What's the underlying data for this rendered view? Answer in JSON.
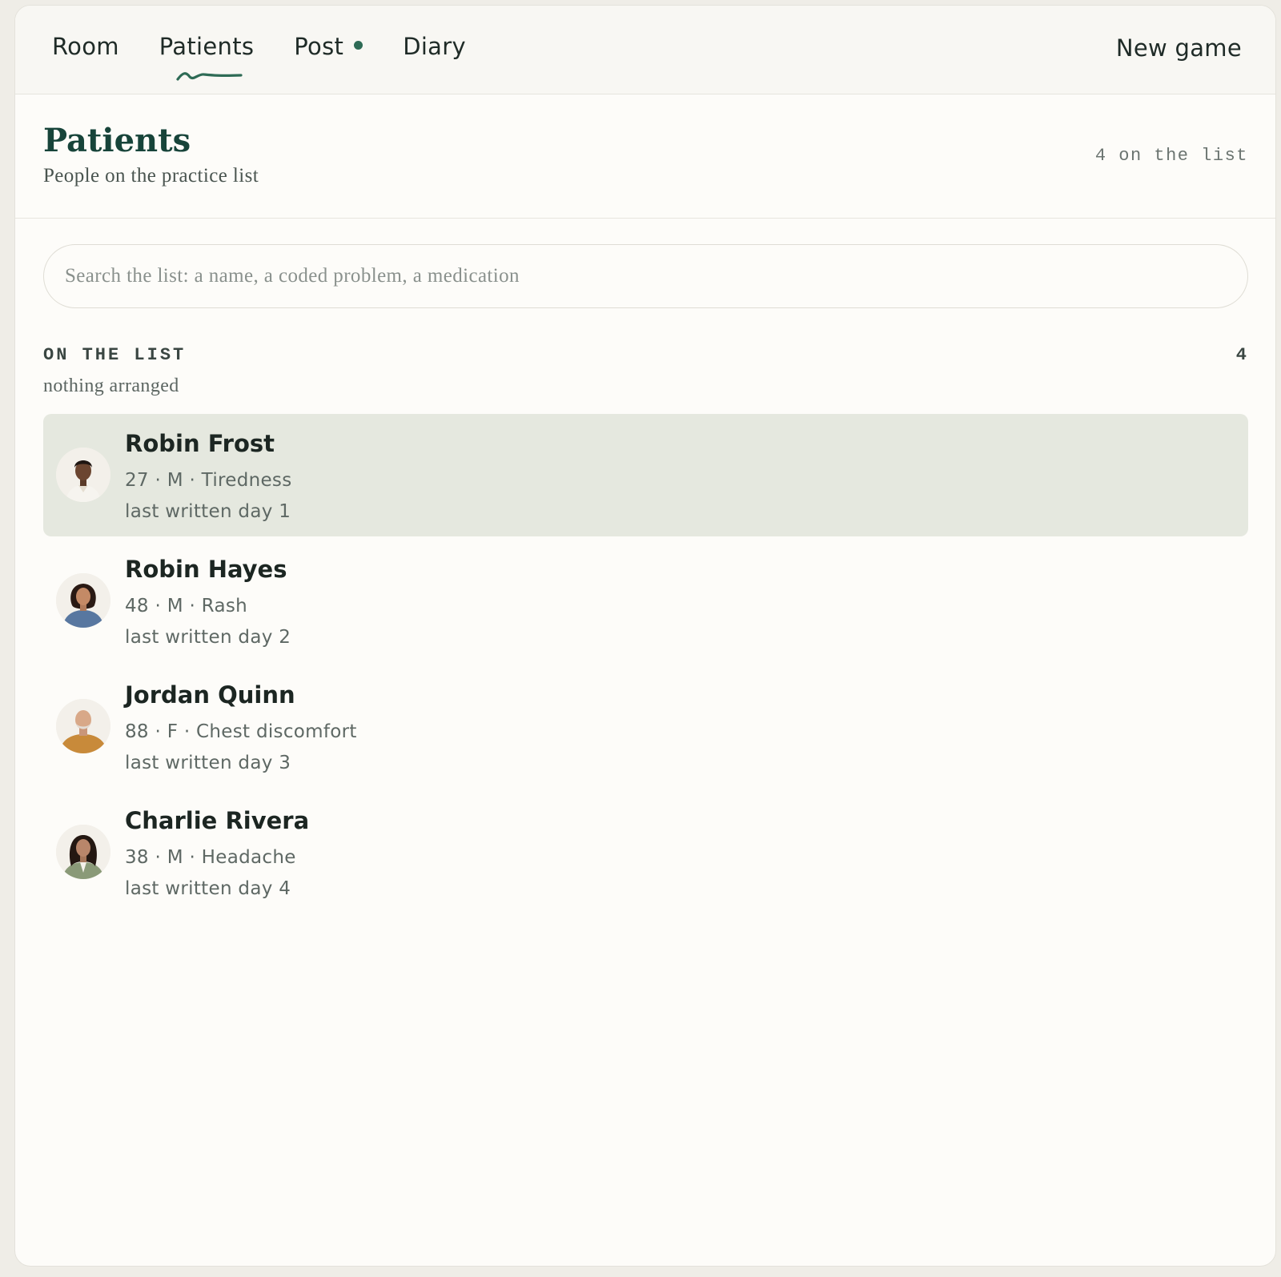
{
  "nav": {
    "tabs": [
      {
        "label": "Room"
      },
      {
        "label": "Patients"
      },
      {
        "label": "Post"
      },
      {
        "label": "Diary"
      }
    ],
    "active_tab": "Patients",
    "new_game_label": "New game",
    "accent_color": "#2e6b55"
  },
  "header": {
    "title": "Patients",
    "subtitle": "People on the practice list",
    "count_label": "4 on the list"
  },
  "search": {
    "placeholder": "Search the list: a name, a coded problem, a medication",
    "value": ""
  },
  "section": {
    "label": "ON THE LIST",
    "count": "4",
    "subtitle": "nothing arranged"
  },
  "patients": [
    {
      "name": "Robin Frost",
      "meta": "27 · M · Tiredness",
      "last": "last written day 1",
      "selected": true
    },
    {
      "name": "Robin Hayes",
      "meta": "48 · M · Rash",
      "last": "last written day 2",
      "selected": false
    },
    {
      "name": "Jordan Quinn",
      "meta": "88 · F · Chest discomfort",
      "last": "last written day 3",
      "selected": false
    },
    {
      "name": "Charlie Rivera",
      "meta": "38 · M · Headache",
      "last": "last written day 4",
      "selected": false
    }
  ]
}
